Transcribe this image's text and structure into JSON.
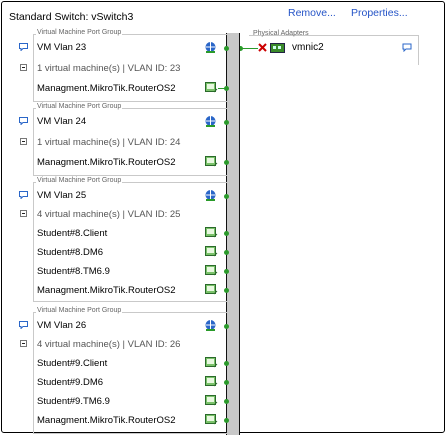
{
  "switch": {
    "title": "Standard Switch: vSwitch3",
    "remove_label": "Remove...",
    "properties_label": "Properties..."
  },
  "physical_adapters": {
    "label": "Physical Adapters",
    "adapters": [
      {
        "name": "vmnic2"
      }
    ]
  },
  "port_groups": [
    {
      "header": "Virtual Machine Port Group",
      "name": "VM Vlan 23",
      "summary": "1 virtual machine(s) | VLAN ID: 23",
      "vms": [
        "Managment.MikroTik.RouterOS2"
      ]
    },
    {
      "header": "Virtual Machine Port Group",
      "name": "VM Vlan 24",
      "summary": "1 virtual machine(s) | VLAN ID: 24",
      "vms": [
        "Managment.MikroTik.RouterOS2"
      ]
    },
    {
      "header": "Virtual Machine Port Group",
      "name": "VM Vlan 25",
      "summary": "4 virtual machine(s) | VLAN ID: 25",
      "vms": [
        "Student#8.Client",
        "Student#8.DM6",
        "Student#8.TM6.9",
        "Managment.MikroTik.RouterOS2"
      ]
    },
    {
      "header": "Virtual Machine Port Group",
      "name": "VM Vlan 26",
      "summary": "4 virtual machine(s) | VLAN ID: 26",
      "vms": [
        "Student#9.Client",
        "Student#9.DM6",
        "Student#9.TM6.9",
        "Managment.MikroTik.RouterOS2"
      ]
    }
  ]
}
